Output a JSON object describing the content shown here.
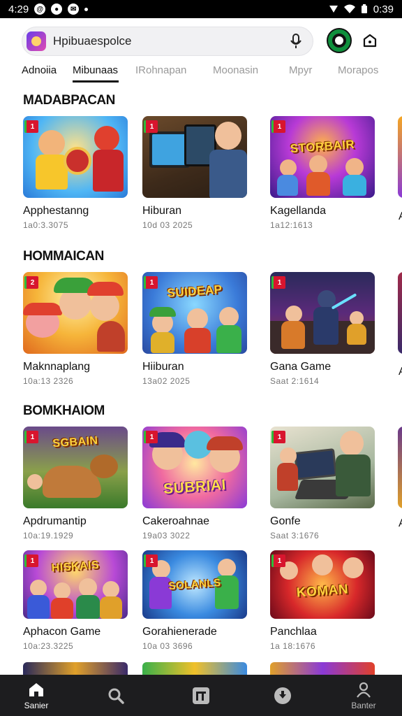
{
  "status_bar": {
    "time": "4:29",
    "clock_right": "0:39"
  },
  "search": {
    "placeholder": "Hpibuaespolce",
    "value": "Hpibuaespolce"
  },
  "tabs": [
    {
      "label": "Adnoiia"
    },
    {
      "label": "Mibunaas"
    },
    {
      "label": "IRohnapan"
    },
    {
      "label": "Moonasin"
    },
    {
      "label": "Mpyr"
    },
    {
      "label": "Morapos"
    }
  ],
  "sections": [
    {
      "title": "MADABPACAN",
      "cards": [
        {
          "title": "Apphestanng",
          "sub": "1a0:3.3075",
          "badge": "1"
        },
        {
          "title": "Hiburan",
          "sub": "10d 03 2025",
          "badge": "1"
        },
        {
          "title": "Kagellanda",
          "sub": "1a12:1613",
          "badge": "1"
        },
        {
          "title": "A"
        }
      ]
    },
    {
      "title": "HOMMAICAN",
      "cards": [
        {
          "title": "Maknnaplang",
          "sub": "10a:13 2326",
          "badge": "2"
        },
        {
          "title": "Hiiburan",
          "sub": "13a02 2025",
          "badge": "1"
        },
        {
          "title": "Gana Game",
          "sub": "Saat 2:1614",
          "badge": "1"
        },
        {
          "title": "A"
        }
      ]
    },
    {
      "title": "BOMKHAIOM",
      "cards": [
        {
          "title": "Apdrumantip",
          "sub": "10a:19.1929",
          "badge": "1",
          "banner": "SGBAIN"
        },
        {
          "title": "Cakeroahnae",
          "sub": "19a03 3022",
          "badge": "1",
          "banner": "SUBRIAI"
        },
        {
          "title": "Gonfe",
          "sub": "Saat 3:1676",
          "badge": "1"
        },
        {
          "title": "A"
        }
      ]
    },
    {
      "title": "",
      "cards": [
        {
          "title": "Aphacon Game",
          "sub": "10a:23.3225",
          "badge": "1",
          "banner": "HISKAIS"
        },
        {
          "title": "Gorahienerade",
          "sub": "10a 03 3696",
          "badge": "1",
          "banner": "SOLANLS"
        },
        {
          "title": "Panchlaa",
          "sub": "1a 18:1676",
          "badge": "1",
          "banner": "KOMAN"
        }
      ]
    }
  ],
  "nav": [
    {
      "label": "Sanier",
      "icon": "home-icon"
    },
    {
      "label": "",
      "icon": "search-icon"
    },
    {
      "label": "",
      "icon": "library-icon"
    },
    {
      "label": "",
      "icon": "download-icon"
    },
    {
      "label": "Banter",
      "icon": "profile-icon"
    }
  ],
  "colors": {
    "accent": "#d8152e",
    "nav_bg": "#1d1d1f",
    "status_bg": "#000000"
  }
}
